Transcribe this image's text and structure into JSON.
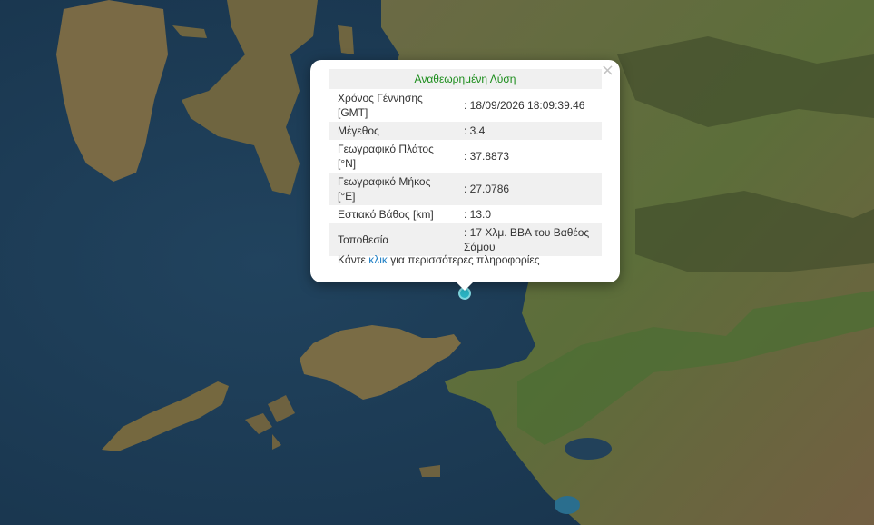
{
  "popup": {
    "title": "Αναθεωρημένη Λύση",
    "rows": [
      {
        "label": "Χρόνος Γέννησης [GMT]",
        "value": ": 18/09/2026 18:09:39.46"
      },
      {
        "label": "Μέγεθος",
        "value": ": 3.4"
      },
      {
        "label": "Γεωγραφικό Πλάτος [°N]",
        "value": ": 37.8873"
      },
      {
        "label": "Γεωγραφικό Μήκος [°E]",
        "value": ": 27.0786"
      },
      {
        "label": "Εστιακό Βάθος [km]",
        "value": ": 13.0"
      },
      {
        "label": "Τοποθεσία",
        "value": ": 17 Χλμ. ΒΒΑ του Βαθέος Σάμου"
      }
    ],
    "more_prefix": "Κάντε ",
    "more_link": "κλικ",
    "more_suffix": " για περισσότερες πληροφορίες",
    "close_icon": "×"
  },
  "colors": {
    "title_text": "#1a8c1a",
    "link": "#1f7fc4",
    "marker": "#2bb5c4",
    "sea": "#1c3a52",
    "land": "#5a6b3c"
  }
}
